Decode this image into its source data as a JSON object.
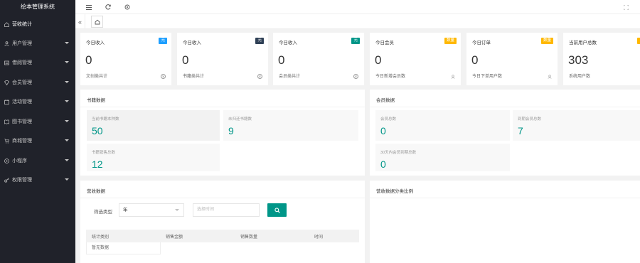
{
  "app": {
    "title": "绘本管理系统"
  },
  "sidebar": {
    "items": [
      {
        "label": "营收统计",
        "icon": "home-icon",
        "has_arrow": false
      },
      {
        "label": "用户管理",
        "icon": "user-icon",
        "has_arrow": true
      },
      {
        "label": "借阅管理",
        "icon": "list-icon",
        "has_arrow": true
      },
      {
        "label": "会员管理",
        "icon": "vip-icon",
        "has_arrow": true
      },
      {
        "label": "活动管理",
        "icon": "activity-icon",
        "has_arrow": true
      },
      {
        "label": "图书管理",
        "icon": "book-icon",
        "has_arrow": true
      },
      {
        "label": "商城管理",
        "icon": "cart-icon",
        "has_arrow": true
      },
      {
        "label": "小程序",
        "icon": "miniapp-icon",
        "has_arrow": true
      },
      {
        "label": "权限管理",
        "icon": "key-icon",
        "has_arrow": true
      }
    ]
  },
  "stats": [
    {
      "title": "今日收入",
      "badge": "元",
      "badge_color": "#1e9fff",
      "value": "0",
      "sub": "文创类共计",
      "icon": "yen-icon"
    },
    {
      "title": "今日收入",
      "badge": "元",
      "badge_color": "#2f4056",
      "value": "0",
      "sub": "书籍类共计",
      "icon": "yen-icon"
    },
    {
      "title": "今日收入",
      "badge": "元",
      "badge_color": "#009688",
      "value": "0",
      "sub": "会员类共计",
      "icon": "yen-icon"
    },
    {
      "title": "今日会员",
      "badge": "数量",
      "badge_color": "#ffb800",
      "value": "0",
      "sub": "今日新增会员数",
      "icon": "person-icon"
    },
    {
      "title": "今日订单",
      "badge": "数量",
      "badge_color": "#ffb800",
      "value": "0",
      "sub": "今日下单用户数",
      "icon": "person-icon"
    },
    {
      "title": "当前用户总数",
      "badge": "",
      "badge_color": "#ffb800",
      "value": "303",
      "sub": "系统用户数",
      "icon": ""
    }
  ],
  "book_panel": {
    "title": "书籍数据",
    "metrics": [
      {
        "label": "当前书籍本种数",
        "value": "50"
      },
      {
        "label": "未归还书籍数",
        "value": "9"
      },
      {
        "label": "书籍销售总数",
        "value": "12"
      }
    ]
  },
  "member_panel": {
    "title": "会员数据",
    "metrics": [
      {
        "label": "会员总数",
        "value": "0"
      },
      {
        "label": "到期会员总数",
        "value": "7"
      },
      {
        "label": "30天内会员到期总数",
        "value": "0"
      }
    ]
  },
  "revenue_panel": {
    "title": "营收数据",
    "filter_label": "筛选类型",
    "filter_value": "年",
    "date_placeholder": "选择时间",
    "search_icon": "search-icon",
    "table": {
      "headers": [
        "统计类别",
        "销售金额",
        "销售数量",
        "时间"
      ],
      "empty": "暂无数据"
    }
  },
  "ratio_panel": {
    "title": "营收数据分类比例"
  },
  "colors": {
    "accent": "#009688",
    "sidebar_bg": "#20222a"
  }
}
